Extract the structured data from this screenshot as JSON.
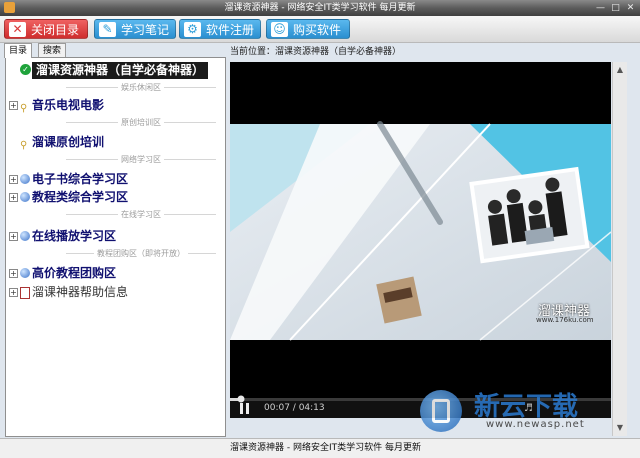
{
  "window": {
    "title": "溜课资源神器 - 网络安全IT类学习软件 每月更新",
    "controls": [
      "minimize",
      "maximize",
      "close"
    ]
  },
  "toolbar": {
    "buttons": [
      {
        "label": "关闭目录",
        "icon": "close-x-icon",
        "color": "#d83a3a"
      },
      {
        "label": "学习笔记",
        "icon": "edit-icon",
        "color": "#2f9fd9"
      },
      {
        "label": "软件注册",
        "icon": "register-icon",
        "color": "#2f9fd9"
      },
      {
        "label": "购买软件",
        "icon": "users-icon",
        "color": "#2f9fd9"
      }
    ]
  },
  "left": {
    "tabs": [
      "目录",
      "搜索"
    ],
    "tree": {
      "root": "溜课资源神器（自学必备神器）",
      "sep_entertainment": "娱乐休闲区",
      "item_music": "音乐电视电影",
      "sep_original": "原创培训区",
      "item_original": "溜课原创培训",
      "sep_network": "网络学习区",
      "item_ebook": "电子书综合学习区",
      "item_tutorial": "教程类综合学习区",
      "sep_online": "在线学习区",
      "item_online": "在线播放学习区",
      "sep_group": "教程团购区（即将开放）",
      "item_group": "高价教程团购区",
      "item_help": "溜课神器帮助信息"
    }
  },
  "location": {
    "label": "当前位置：",
    "path": "溜课资源神器（自学必备神器）"
  },
  "player": {
    "brand": "溜课神器",
    "url": "www.176ku.com",
    "time": "00:07 / 04:13",
    "progress": 0.028
  },
  "watermark": {
    "name": "新云下载",
    "url": "www.newasp.net"
  },
  "status": {
    "text": "溜课资源神器 - 网络安全IT类学习软件 每月更新"
  }
}
